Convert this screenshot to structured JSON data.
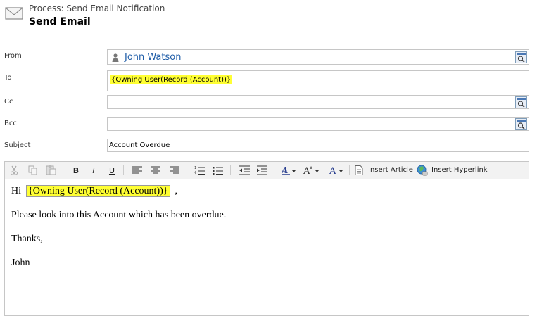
{
  "header": {
    "process_label": "Process: Send Email Notification",
    "title": "Send Email",
    "icon": "envelope-icon"
  },
  "form": {
    "from_label": "From",
    "from_value": "John Watson",
    "to_label": "To",
    "to_value": "{Owning User(Record (Account))}",
    "cc_label": "Cc",
    "bcc_label": "Bcc",
    "subject_label": "Subject",
    "subject_value": "Account Overdue"
  },
  "toolbar": {
    "bold": "B",
    "italic": "I",
    "underline": "U",
    "insert_article": "Insert Article",
    "insert_hyperlink": "Insert Hyperlink"
  },
  "body": {
    "greeting": "Hi",
    "token": "{Owning User(Record (Account))}",
    "comma": ",",
    "line1": "Please look into this Account which has been overdue.",
    "line2": "Thanks,",
    "line3": "John"
  },
  "colors": {
    "highlight": "#ffff33",
    "link_blue": "#1f5da8",
    "border": "#c6c6c6"
  }
}
